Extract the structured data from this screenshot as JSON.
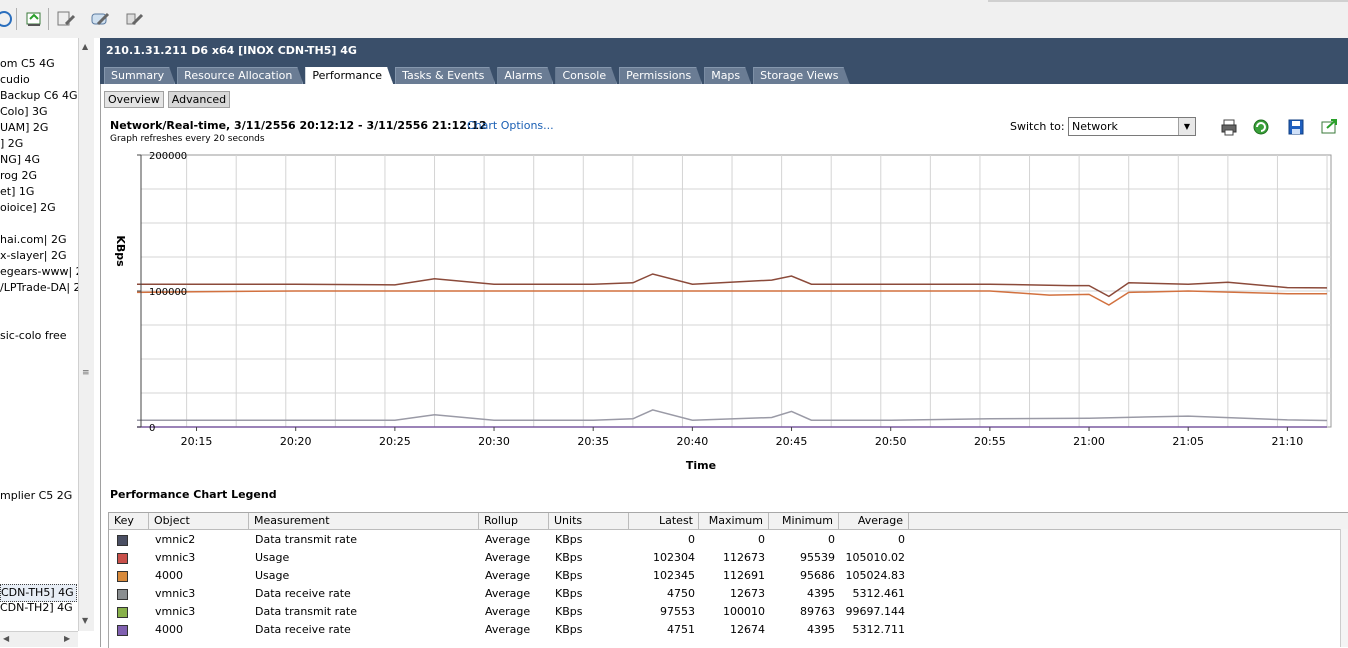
{
  "toolbar": {
    "icons": [
      "refresh-icon",
      "export-icon",
      "edit-settings-icon",
      "console-icon",
      "tools-icon"
    ]
  },
  "left_tree": {
    "items": [
      {
        "label": "om C5 4G"
      },
      {
        "label": "cudio"
      },
      {
        "label": "Backup C6 4G"
      },
      {
        "label": "Colo] 3G"
      },
      {
        "label": "UAM] 2G"
      },
      {
        "label": "] 2G"
      },
      {
        "label": "NG] 4G"
      },
      {
        "label": "rog 2G"
      },
      {
        "label": "et] 1G"
      },
      {
        "label": "oioice] 2G"
      },
      {
        "label": "hai.com| 2G"
      },
      {
        "label": "x-slayer| 2G"
      },
      {
        "label": "egears-www| 2("
      },
      {
        "label": "/LPTrade-DA| 2"
      },
      {
        "label": "sic-colo free"
      },
      {
        "label": "mplier C5 2G"
      },
      {
        "label": "CDN-TH5] 4G"
      },
      {
        "label": "CDN-TH2] 4G"
      }
    ]
  },
  "header": {
    "title": "210.1.31.211 D6 x64 [INOX CDN-TH5] 4G",
    "tabs": [
      {
        "label": "Summary",
        "active": false
      },
      {
        "label": "Resource Allocation",
        "active": false
      },
      {
        "label": "Performance",
        "active": true
      },
      {
        "label": "Tasks & Events",
        "active": false
      },
      {
        "label": "Alarms",
        "active": false
      },
      {
        "label": "Console",
        "active": false
      },
      {
        "label": "Permissions",
        "active": false
      },
      {
        "label": "Maps",
        "active": false
      },
      {
        "label": "Storage Views",
        "active": false
      }
    ]
  },
  "subtabs": {
    "overview": "Overview",
    "advanced": "Advanced"
  },
  "chart_header": {
    "title": "Network/Real-time, 3/11/2556 20:12:12 - 3/11/2556 21:12:12",
    "options_link": "Chart Options...",
    "refresh_note": "Graph refreshes every 20 seconds",
    "switch_label": "Switch to:",
    "switch_value": "Network"
  },
  "chart_data": {
    "type": "line",
    "xlabel": "Time",
    "ylabel": "KBps",
    "ylim": [
      0,
      200000
    ],
    "yticks": [
      "200000",
      "100000",
      "0"
    ],
    "xticks": [
      "20:15",
      "20:20",
      "20:25",
      "20:30",
      "20:35",
      "20:40",
      "20:45",
      "20:50",
      "20:55",
      "21:00",
      "21:05",
      "21:10"
    ],
    "grid": true,
    "series": [
      {
        "name": "vmnic3",
        "color": "#8b4a3a",
        "x": [
          "20:12",
          "20:15",
          "20:20",
          "20:25",
          "20:27",
          "20:30",
          "20:35",
          "20:37",
          "20:38",
          "20:40",
          "20:44",
          "20:45",
          "20:46",
          "20:50",
          "20:55",
          "20:59",
          "21:00",
          "21:01",
          "21:02",
          "21:05",
          "21:07",
          "21:10",
          "21:12"
        ],
        "values": [
          105000,
          105000,
          105000,
          104500,
          109000,
          105000,
          105000,
          106000,
          112500,
          105000,
          108000,
          111000,
          105000,
          105000,
          105000,
          104000,
          104000,
          96000,
          106000,
          105000,
          106500,
          102500,
          102300
        ]
      },
      {
        "name": "4000",
        "color": "#d2713f",
        "x": [
          "20:12",
          "20:15",
          "20:20",
          "20:25",
          "20:30",
          "20:35",
          "20:40",
          "20:45",
          "20:50",
          "20:55",
          "20:58",
          "21:00",
          "21:01",
          "21:02",
          "21:05",
          "21:10",
          "21:12"
        ],
        "values": [
          99000,
          99500,
          100000,
          100000,
          100000,
          100000,
          100000,
          100000,
          100000,
          100000,
          97000,
          97500,
          89700,
          99000,
          100000,
          98000,
          98000
        ]
      },
      {
        "name": "vmnic3",
        "color": "#9a9aa6",
        "x": [
          "20:12",
          "20:15",
          "20:20",
          "20:25",
          "20:27",
          "20:30",
          "20:35",
          "20:37",
          "20:38",
          "20:40",
          "20:44",
          "20:45",
          "20:46",
          "20:50",
          "20:55",
          "21:00",
          "21:05",
          "21:10",
          "21:12"
        ],
        "values": [
          5000,
          5000,
          5000,
          5000,
          9000,
          5000,
          5000,
          6000,
          12600,
          5000,
          7000,
          11500,
          5000,
          5000,
          6000,
          6500,
          8000,
          5200,
          4750
        ]
      },
      {
        "name": "4000",
        "color": "#7a5aa0",
        "x": [
          "20:12",
          "21:12"
        ],
        "values": [
          0,
          0
        ]
      }
    ]
  },
  "legend": {
    "title": "Performance Chart Legend",
    "columns": [
      "Key",
      "Object",
      "Measurement",
      "Rollup",
      "Units",
      "Latest",
      "Maximum",
      "Minimum",
      "Average"
    ],
    "rows": [
      {
        "color": "#4a4f63",
        "object": "vmnic2",
        "measurement": "Data transmit rate",
        "rollup": "Average",
        "units": "KBps",
        "latest": "0",
        "maximum": "0",
        "minimum": "0",
        "average": "0"
      },
      {
        "color": "#c8504a",
        "object": "vmnic3",
        "measurement": "Usage",
        "rollup": "Average",
        "units": "KBps",
        "latest": "102304",
        "maximum": "112673",
        "minimum": "95539",
        "average": "105010.02"
      },
      {
        "color": "#d88a3c",
        "object": "4000",
        "measurement": "Usage",
        "rollup": "Average",
        "units": "KBps",
        "latest": "102345",
        "maximum": "112691",
        "minimum": "95686",
        "average": "105024.83"
      },
      {
        "color": "#8a8e90",
        "object": "vmnic3",
        "measurement": "Data receive rate",
        "rollup": "Average",
        "units": "KBps",
        "latest": "4750",
        "maximum": "12673",
        "minimum": "4395",
        "average": "5312.461"
      },
      {
        "color": "#88b04a",
        "object": "vmnic3",
        "measurement": "Data transmit rate",
        "rollup": "Average",
        "units": "KBps",
        "latest": "97553",
        "maximum": "100010",
        "minimum": "89763",
        "average": "99697.144"
      },
      {
        "color": "#8060b0",
        "object": "4000",
        "measurement": "Data receive rate",
        "rollup": "Average",
        "units": "KBps",
        "latest": "4751",
        "maximum": "12674",
        "minimum": "4395",
        "average": "5312.711"
      }
    ]
  }
}
